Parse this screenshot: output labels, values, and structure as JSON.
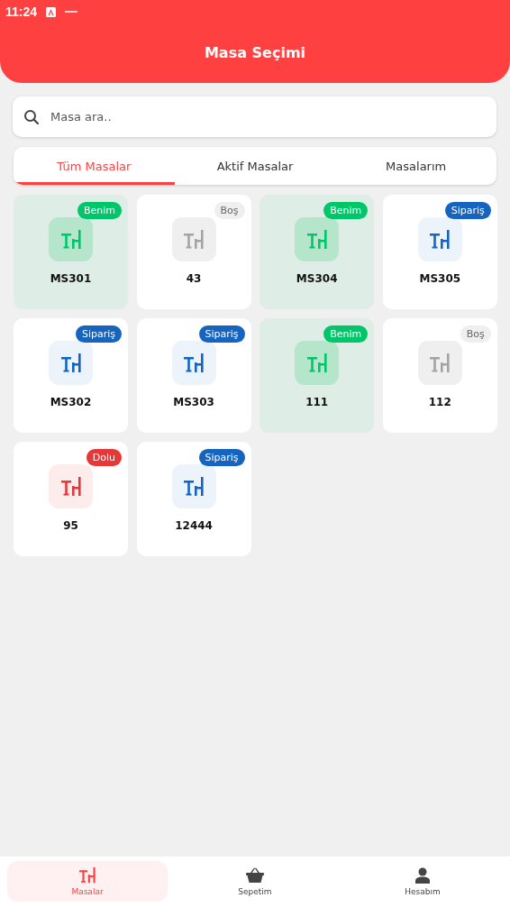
{
  "status_bar": {
    "time": "11:24"
  },
  "header": {
    "title": "Masa Seçimi"
  },
  "search": {
    "placeholder": "Masa ara.."
  },
  "tabs": [
    {
      "label": "Tüm Masalar",
      "selected": true
    },
    {
      "label": "Aktif Masalar",
      "selected": false
    },
    {
      "label": "Masalarım",
      "selected": false
    }
  ],
  "tables": [
    {
      "name": "MS301",
      "badge": "Benim",
      "kind": "mine"
    },
    {
      "name": "43",
      "badge": "Boş",
      "kind": "empty"
    },
    {
      "name": "MS304",
      "badge": "Benim",
      "kind": "mine"
    },
    {
      "name": "MS305",
      "badge": "Sipariş",
      "kind": "order"
    },
    {
      "name": "MS302",
      "badge": "Sipariş",
      "kind": "order"
    },
    {
      "name": "MS303",
      "badge": "Sipariş",
      "kind": "order"
    },
    {
      "name": "111",
      "badge": "Benim",
      "kind": "mine"
    },
    {
      "name": "112",
      "badge": "Boş",
      "kind": "empty"
    },
    {
      "name": "95",
      "badge": "Dolu",
      "kind": "full"
    },
    {
      "name": "12444",
      "badge": "Sipariş",
      "kind": "order"
    }
  ],
  "bottom_nav": [
    {
      "label": "Masalar",
      "kind": "table",
      "selected": true
    },
    {
      "label": "Sepetim",
      "kind": "basket",
      "selected": false
    },
    {
      "label": "Hesabım",
      "kind": "person",
      "selected": false
    }
  ]
}
